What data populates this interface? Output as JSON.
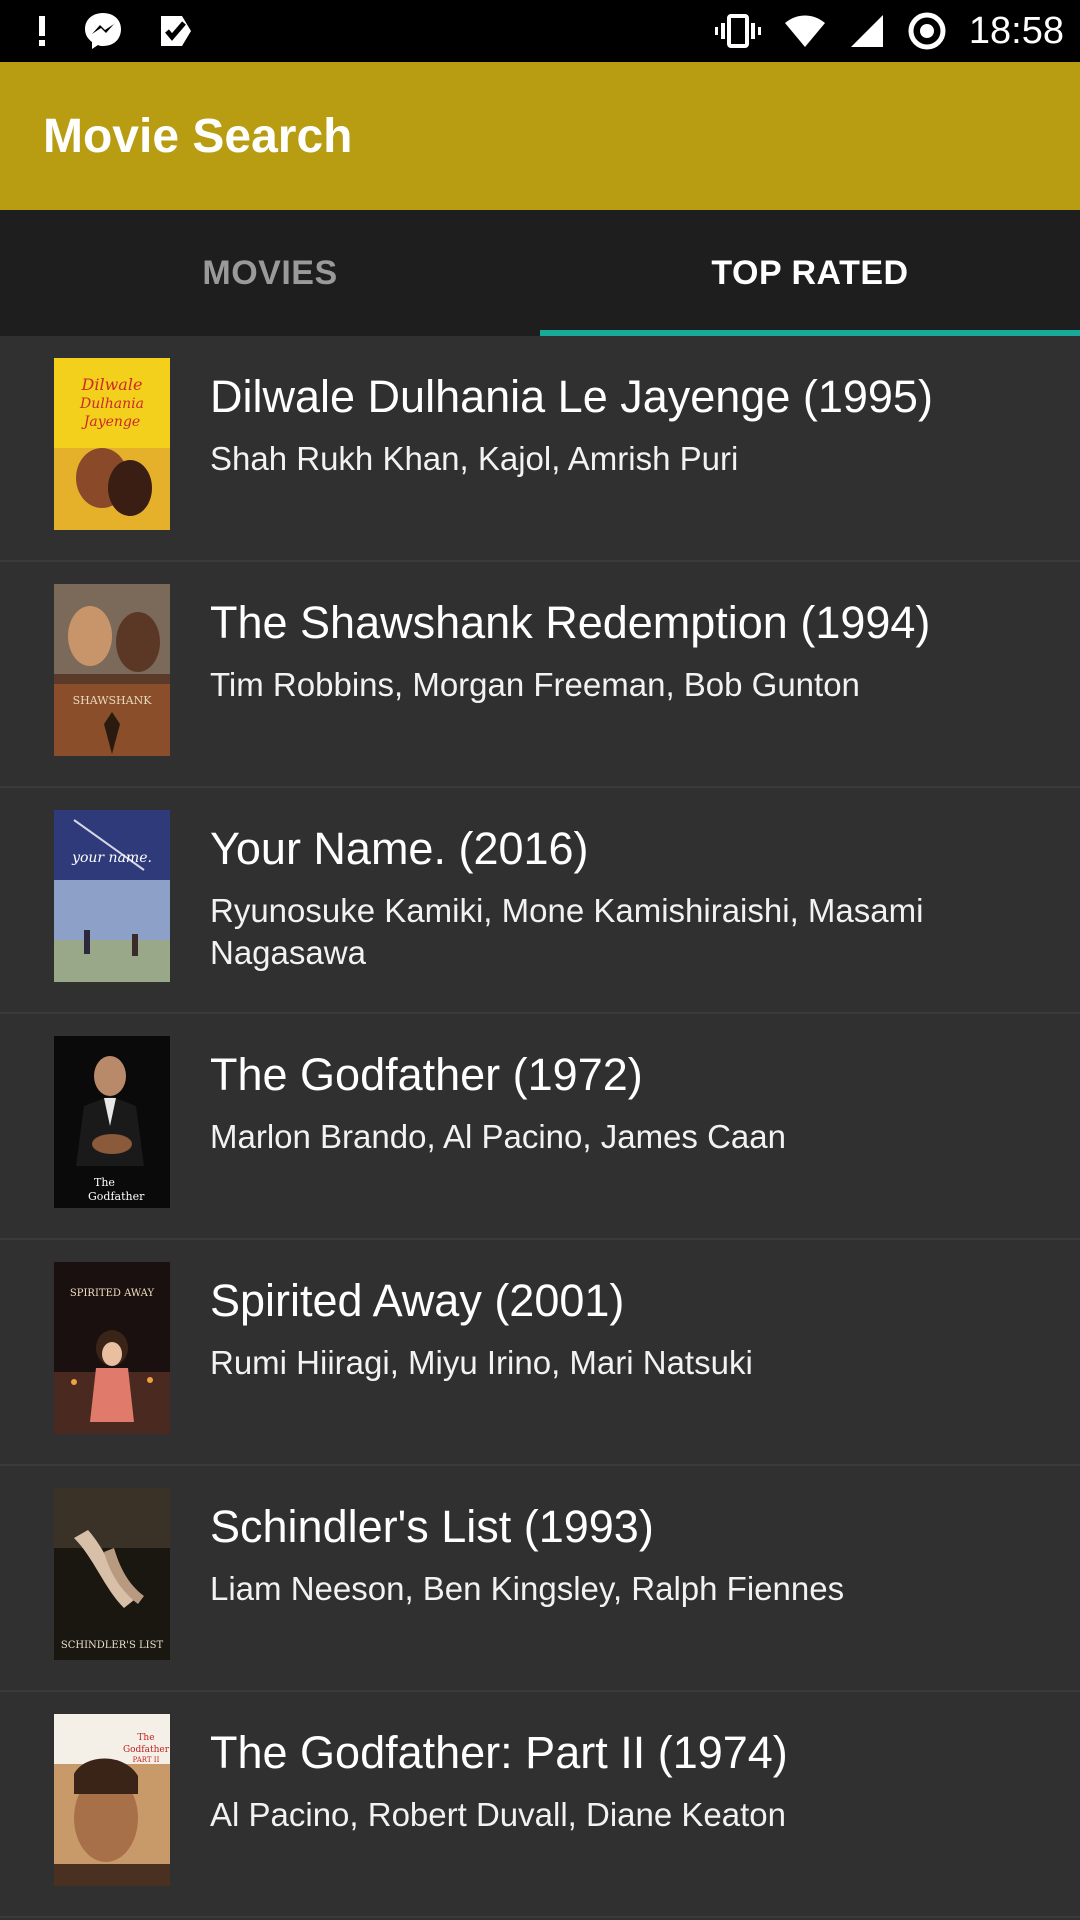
{
  "status_bar": {
    "time": "18:58",
    "left_icons": [
      "alert-icon",
      "messenger-icon",
      "checklist-icon"
    ],
    "right_icons": [
      "vibrate-icon",
      "wifi-icon",
      "signal-icon",
      "sync-icon"
    ]
  },
  "app_bar": {
    "title": "Movie Search"
  },
  "tabs": [
    {
      "label": "MOVIES",
      "active": false
    },
    {
      "label": "TOP RATED",
      "active": true
    }
  ],
  "colors": {
    "app_bar": "#b89c11",
    "tab_indicator": "#18a999",
    "tabs_bg": "#1e1e1e",
    "list_bg": "#303030"
  },
  "movies": [
    {
      "title": "Dilwale Dulhania Le Jayenge (1995)",
      "cast": "Shah Rukh Khan, Kajol, Amrish Puri",
      "poster_text": "Dilwale Dulhania Le Jayenge"
    },
    {
      "title": "The Shawshank Redemption (1994)",
      "cast": "Tim Robbins, Morgan Freeman, Bob Gunton",
      "poster_text": "SHAWSHANK"
    },
    {
      "title": "Your Name. (2016)",
      "cast": "Ryunosuke Kamiki, Mone Kamishiraishi, Masami Nagasawa",
      "poster_text": "your name."
    },
    {
      "title": "The Godfather (1972)",
      "cast": "Marlon Brando, Al Pacino, James Caan",
      "poster_text": "The Godfather"
    },
    {
      "title": "Spirited Away (2001)",
      "cast": "Rumi Hiiragi, Miyu Irino, Mari Natsuki",
      "poster_text": "Spirited Away"
    },
    {
      "title": "Schindler's List (1993)",
      "cast": "Liam Neeson, Ben Kingsley, Ralph Fiennes",
      "poster_text": "Schindler's List"
    },
    {
      "title": "The Godfather: Part II (1974)",
      "cast": "Al Pacino, Robert Duvall, Diane Keaton",
      "poster_text": "The Godfather Part II"
    }
  ]
}
